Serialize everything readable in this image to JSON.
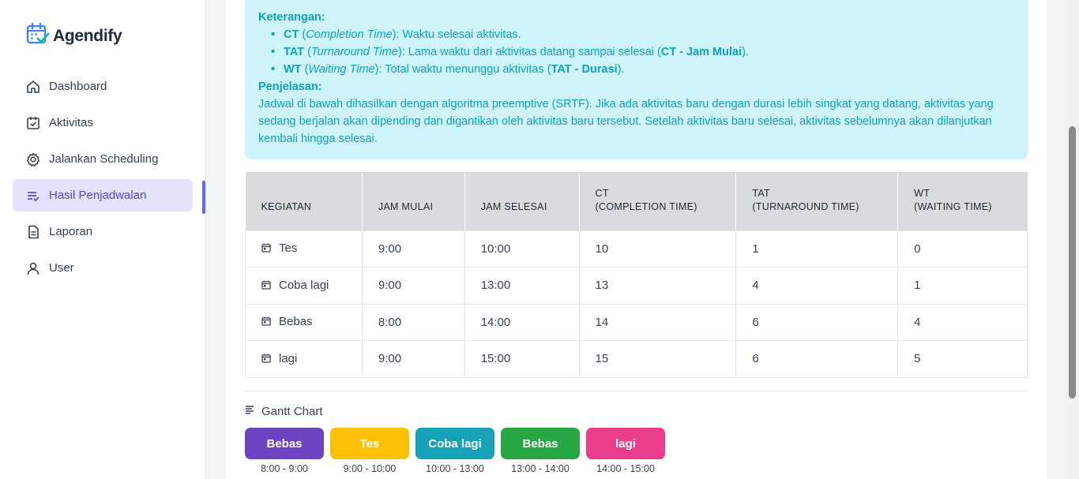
{
  "brand": {
    "name": "Agendify",
    "icon": "calendar-check-icon",
    "accent": "#3b82f6"
  },
  "sidebar": {
    "items": [
      {
        "label": "Dashboard",
        "icon": "home-icon",
        "active": false
      },
      {
        "label": "Aktivitas",
        "icon": "calendar-check-icon",
        "active": false
      },
      {
        "label": "Jalankan Scheduling",
        "icon": "gear-icon",
        "active": false
      },
      {
        "label": "Hasil Penjadwalan",
        "icon": "list-icon",
        "active": true
      },
      {
        "label": "Laporan",
        "icon": "document-icon",
        "active": false
      },
      {
        "label": "User",
        "icon": "user-icon",
        "active": false
      }
    ]
  },
  "info": {
    "keterangan_title": "Keterangan:",
    "items": [
      {
        "abbr": "CT",
        "open": " (",
        "term": "Completion Time",
        "desc": "): Waktu selesai aktivitas.",
        "formula": "",
        "end": ""
      },
      {
        "abbr": "TAT",
        "open": " (",
        "term": "Turnaround Time",
        "desc": "): Lama waktu dari aktivitas datang sampai selesai (",
        "formula": "CT - Jam Mulai",
        "end": ")."
      },
      {
        "abbr": "WT",
        "open": " (",
        "term": "Waiting Time",
        "desc": "): Total waktu menunggu aktivitas (",
        "formula": "TAT - Durasi",
        "end": ")."
      }
    ],
    "penjelasan_title": "Penjelasan:",
    "penjelasan_text": "Jadwal di bawah dihasilkan dengan algoritma preemptive (SRTF). Jika ada aktivitas baru dengan durasi lebih singkat yang datang, aktivitas yang sedang berjalan akan dipending dan digantikan oleh aktivitas baru tersebut. Setelah aktivitas baru selesai, aktivitas sebelumnya akan dilanjutkan kembali hingga selesai."
  },
  "table": {
    "headers": [
      {
        "line1": "",
        "line2": "KEGIATAN"
      },
      {
        "line1": "",
        "line2": "JAM MULAI"
      },
      {
        "line1": "",
        "line2": "JAM SELESAI"
      },
      {
        "line1": "CT",
        "line2": "(COMPLETION TIME)"
      },
      {
        "line1": "TAT",
        "line2": "(TURNAROUND TIME)"
      },
      {
        "line1": "WT",
        "line2": "(WAITING TIME)"
      }
    ],
    "rows": [
      {
        "kegiatan": "Tes",
        "mulai": "9:00",
        "selesai": "10:00",
        "ct": "10",
        "tat": "1",
        "wt": "0"
      },
      {
        "kegiatan": "Coba lagi",
        "mulai": "9:00",
        "selesai": "13:00",
        "ct": "13",
        "tat": "4",
        "wt": "1"
      },
      {
        "kegiatan": "Bebas",
        "mulai": "8:00",
        "selesai": "14:00",
        "ct": "14",
        "tat": "6",
        "wt": "4"
      },
      {
        "kegiatan": "lagi",
        "mulai": "9:00",
        "selesai": "15:00",
        "ct": "15",
        "tat": "6",
        "wt": "5"
      }
    ]
  },
  "gantt": {
    "title": "Gantt Chart",
    "icon": "bars-icon",
    "blocks": [
      {
        "label": "Bebas",
        "time": "8:00 - 9:00",
        "color": "#6f42c1"
      },
      {
        "label": "Tes",
        "time": "9:00 - 10:00",
        "color": "#ffc107"
      },
      {
        "label": "Coba lagi",
        "time": "10:00 - 13:00",
        "color": "#17a2b8"
      },
      {
        "label": "Bebas",
        "time": "13:00 - 14:00",
        "color": "#28a745"
      },
      {
        "label": "lagi",
        "time": "14:00 - 15:00",
        "color": "#e83e8c"
      }
    ]
  }
}
